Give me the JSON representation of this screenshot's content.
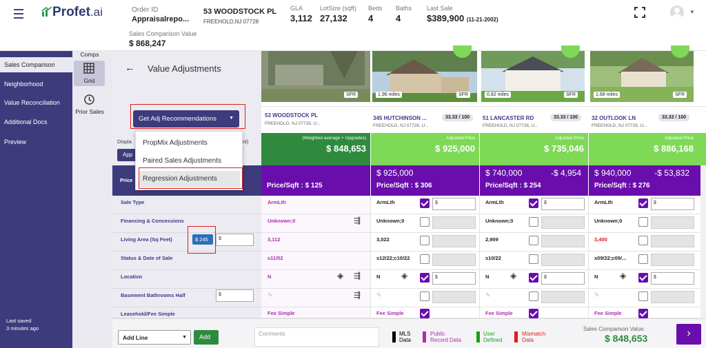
{
  "app": {
    "logo": "Profet",
    "logo_suffix": ".ai"
  },
  "header": {
    "order_label": "Order ID",
    "order_value": "Appraisalrepo...",
    "address_line1": "53 WOODSTOCK PL",
    "address_line2": "FREEHOLD,NJ 07728",
    "gla_label": "GLA",
    "gla_value": "3,112",
    "lot_label": "LotSize (sqft)",
    "lot_value": "27,132",
    "beds_label": "Beds",
    "beds_value": "4",
    "baths_label": "Baths",
    "baths_value": "4",
    "sale_label": "Last Sale",
    "sale_value": "$389,900",
    "sale_date": "(11-21-2002)",
    "scv_label": "Sales Comparison Value",
    "scv_value": "$ 868,247"
  },
  "sidebar": {
    "items": [
      "Sales Comparison",
      "Neighborhood",
      "Value Reconciliation",
      "Additional Docs",
      "Preview"
    ],
    "last_saved": "Last saved",
    "last_saved_ago": "3 minutes ago"
  },
  "col2": {
    "comps": "Comps",
    "grid": "Grid",
    "prior": "Prior Sales"
  },
  "page_title": "Value Adjustments",
  "get_adj_button": "Get Adj Recommendations",
  "menu": [
    "PropMix Adjustments",
    "Paired Sales Adjustments",
    "Regression Adjustments"
  ],
  "display_label": "Displa",
  "display_trail": "nl)",
  "apply_btn": "App",
  "subject": {
    "badge": "SFR",
    "name": "53 WOODSTOCK PL",
    "addr": "FREEHOLD, NJ 07728, U...",
    "adj_label": "(Weighted average + Upgrades)",
    "adj_value": "$ 848,653",
    "ppsf": "Price/Sqft : $ 125"
  },
  "comps": [
    {
      "miles": "1.96 miles",
      "badge": "SFR",
      "name": "345 HUTCHINSON ...",
      "addr": "FREEHOLD, NJ 07728, U...",
      "score": "33.33 / 100",
      "adj_label": "Adjusted Price",
      "adj_value": "$ 925,000",
      "price": "$ 925,000",
      "diff": "",
      "ppsf": "Price/Sqft : $ 306"
    },
    {
      "miles": "0.82 miles",
      "badge": "SFR",
      "name": "51 LANCASTER RD",
      "addr": "FREEHOLD, NJ 07728, U...",
      "score": "33.33 / 100",
      "adj_label": "Adjusted Price",
      "adj_value": "$ 735,046",
      "price": "$ 740,000",
      "diff": "-$ 4,954",
      "ppsf": "Price/Sqft : $ 254"
    },
    {
      "miles": "1.68 miles",
      "badge": "SFR",
      "name": "32 OUTLOOK LN",
      "addr": "FREEHOLD, NJ 07728, U...",
      "score": "33.33 / 100",
      "adj_label": "Adjusted Price",
      "adj_value": "$ 886,168",
      "price": "$ 940,000",
      "diff": "-$ 53,832",
      "ppsf": "Price/Sqft : $ 276"
    }
  ],
  "price_label": "Price",
  "rows": [
    {
      "label": "Sale Type",
      "subject": "ArmLth",
      "c": [
        "ArmLth",
        "ArmLth",
        "ArmLth"
      ]
    },
    {
      "label": "Financing & Concessions",
      "subject": "Unknown;0",
      "c": [
        "Unknown;0",
        "Unknown;0",
        "Unknown;0"
      ]
    },
    {
      "label": "Living Area (Sq Feet)",
      "subject": "3,112",
      "c": [
        "3,022",
        "2,909",
        "3,400"
      ],
      "rec": "$ 245"
    },
    {
      "label": "Status & Date of Sale",
      "subject": "s11/02",
      "c": [
        "s12/22;c10/22",
        "s10/22",
        "s09/22;c09/..."
      ]
    },
    {
      "label": "Location",
      "subject": "N",
      "c": [
        "N",
        "N",
        "N"
      ]
    },
    {
      "label": "Basement Bathrooms Half",
      "subject": "",
      "c": [
        "",
        "",
        ""
      ]
    },
    {
      "label": "Leasehold/Fee Simple",
      "subject": "Fee Simple",
      "c": [
        "Fee Simple",
        "Fee Simple",
        "Fee Simple"
      ]
    }
  ],
  "dollar": "$",
  "footer": {
    "add_line": "Add Line",
    "add_btn": "Add",
    "comments_placeholder": "Comments",
    "legend": [
      {
        "l1": "MLS",
        "l2": "Data",
        "color": "#000000"
      },
      {
        "l1": "Public",
        "l2": "Record Data",
        "color": "#b12bb1"
      },
      {
        "l1": "User",
        "l2": "Defined",
        "color": "#1aa01a"
      },
      {
        "l1": "Mismatch",
        "l2": "Data",
        "color": "#e21b1b"
      }
    ],
    "scv_label": "Sales Comparison Value:",
    "scv_value": "$ 848,653"
  },
  "colors": {
    "brand": "#3d3b7c",
    "accent": "#6a0dad",
    "green": "#2e8b3e",
    "light_green": "#7ed957"
  }
}
